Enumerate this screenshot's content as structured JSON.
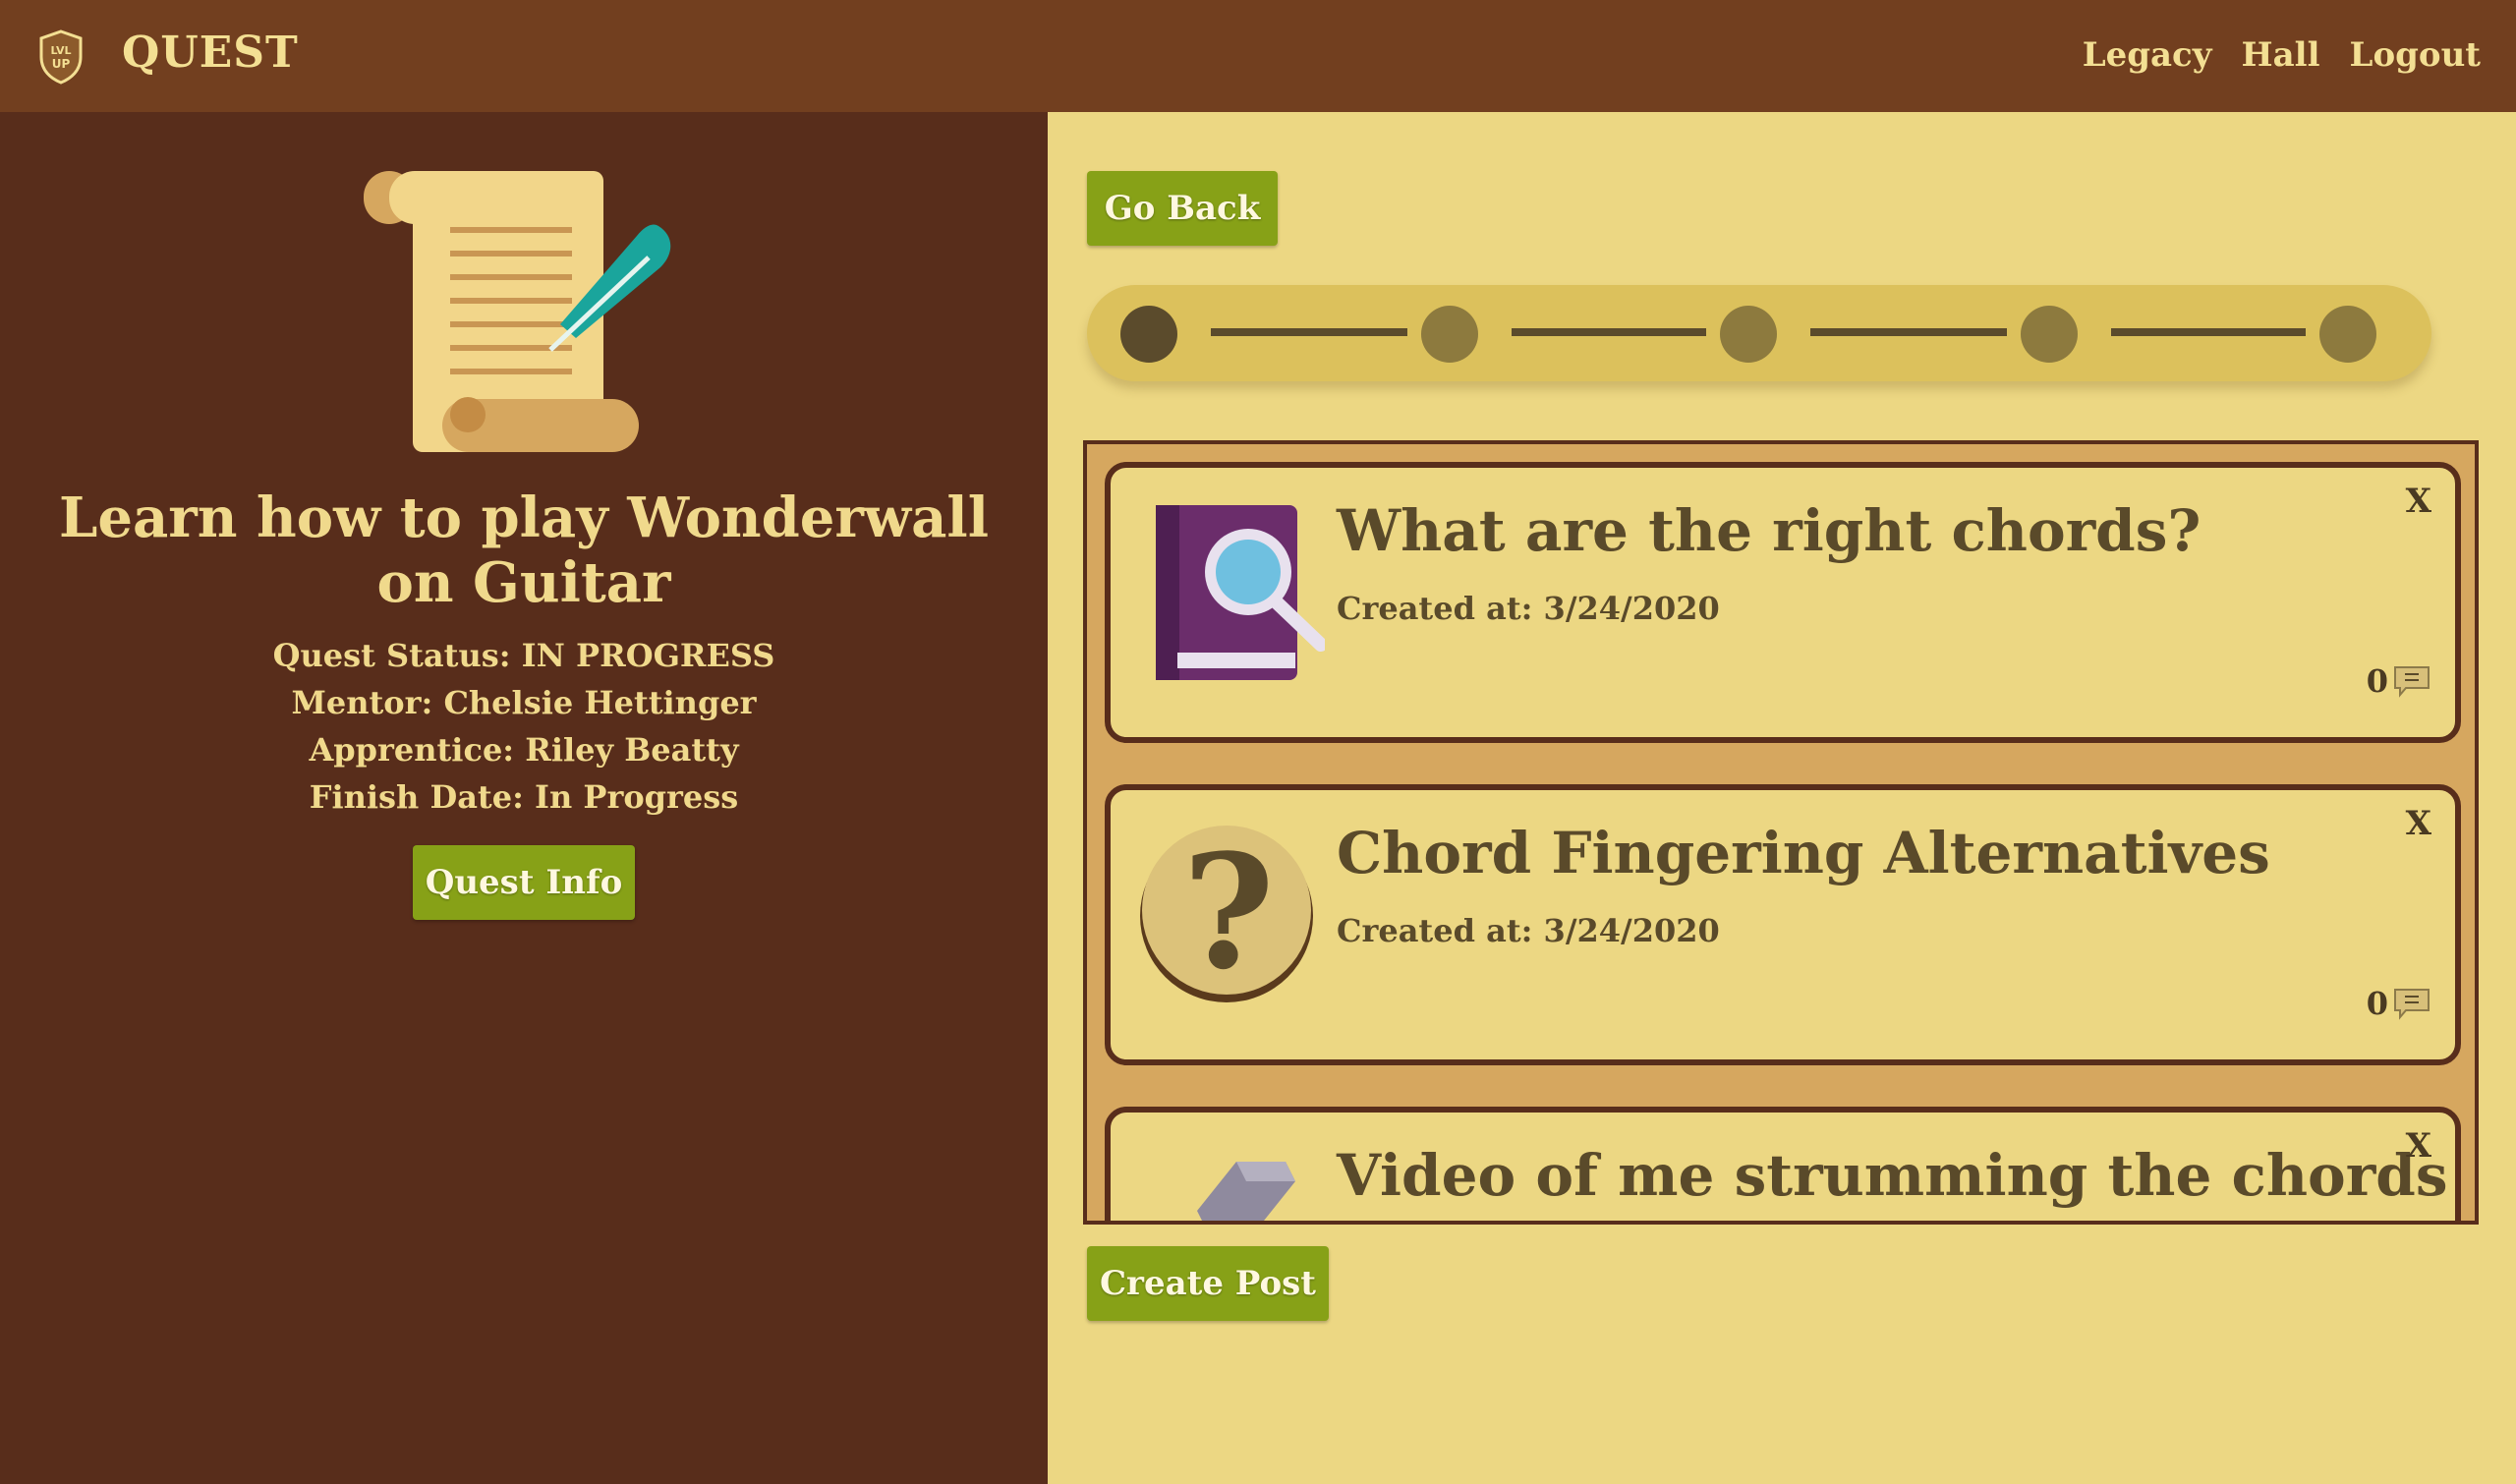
{
  "header": {
    "logo_text": "LVL UP",
    "brand": "QUEST",
    "nav": [
      "Legacy",
      "Hall",
      "Logout"
    ]
  },
  "quest": {
    "title": "Learn how to play Wonderwall on Guitar",
    "status": "Quest Status: IN PROGRESS",
    "mentor": "Mentor: Chelsie Hettinger",
    "apprentice": "Apprentice: Riley Beatty",
    "finish": "Finish Date: In Progress",
    "info_button": "Quest Info"
  },
  "actions": {
    "go_back": "Go Back",
    "create_post": "Create Post"
  },
  "progress": {
    "steps": 5,
    "current": 1
  },
  "posts": [
    {
      "title": "What are the right chords?",
      "date": "Created at: 3/24/2020",
      "comments": "0",
      "close": "X",
      "icon": "book-magnifier-icon"
    },
    {
      "title": "Chord Fingering Alternatives",
      "date": "Created at: 3/24/2020",
      "comments": "0",
      "close": "X",
      "icon": "question-mark-icon"
    },
    {
      "title": "Video of me strumming the chords",
      "date": "",
      "comments": "",
      "close": "X",
      "icon": "pencil-icon"
    }
  ],
  "colors": {
    "header_bg": "#723f1f",
    "sidebar_bg": "#582d1b",
    "page_bg": "#ecd783",
    "button_green": "#87a117",
    "text_cream": "#f0d98c",
    "text_dark": "#5a4a2a"
  }
}
